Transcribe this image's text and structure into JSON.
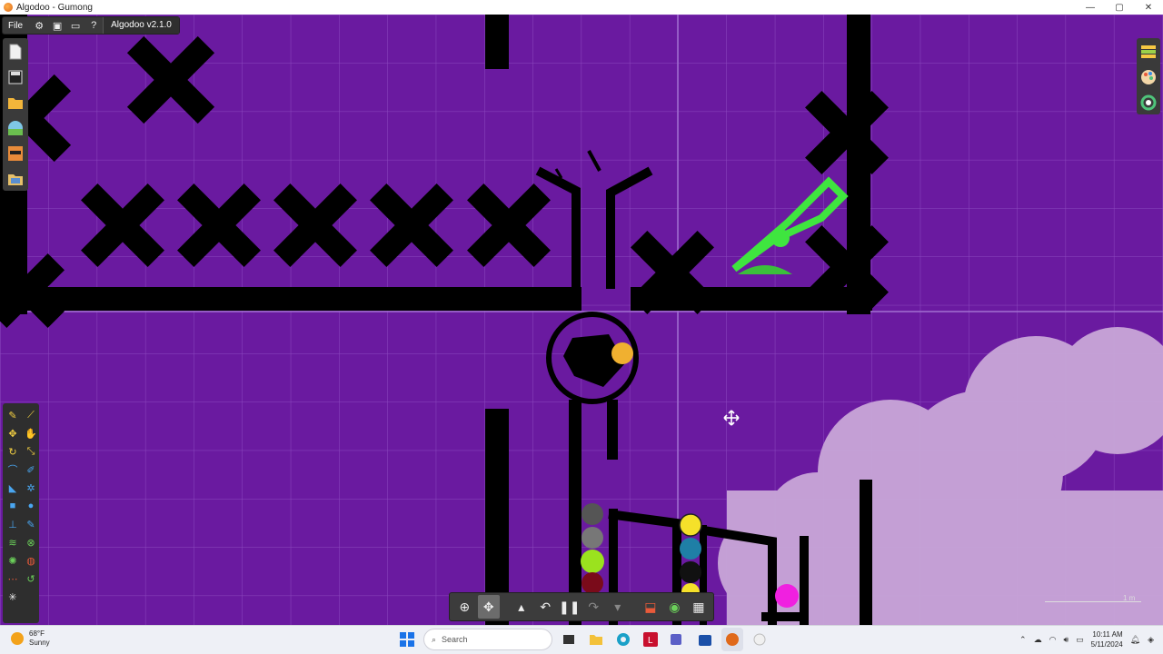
{
  "window": {
    "title": "Algodoo - Gumong",
    "controls": {
      "minimize": "—",
      "maximize": "▢",
      "close": "✕"
    }
  },
  "menu": {
    "file_label": "File",
    "version_label": "Algodoo v2.1.0",
    "buttons": [
      {
        "name": "settings-gear-icon",
        "glyph": "⚙"
      },
      {
        "name": "screen-icon",
        "glyph": "▣"
      },
      {
        "name": "window-icon",
        "glyph": "▭"
      },
      {
        "name": "help-icon",
        "glyph": "?"
      }
    ]
  },
  "left_toolbar": [
    {
      "name": "new-scene-icon",
      "color": "#f1f1f1"
    },
    {
      "name": "save-icon",
      "color": "#e6e6e6"
    },
    {
      "name": "open-folder-icon",
      "color": "#f3b63a"
    },
    {
      "name": "scene-browser-icon",
      "color": "#7fc7e6"
    },
    {
      "name": "character-icon",
      "color": "#e88b3a"
    },
    {
      "name": "library-icon",
      "color": "#e6c06a"
    }
  ],
  "right_toolbar": [
    {
      "name": "layers-icon",
      "color": "#f5c842"
    },
    {
      "name": "palette-icon",
      "color": "#e85a3a"
    },
    {
      "name": "visualization-icon",
      "color": "#4fc47a"
    }
  ],
  "tools": [
    {
      "name": "sketch-tool-icon",
      "glyph": "✎",
      "color": "#f5d142"
    },
    {
      "name": "cut-tool-icon",
      "glyph": "⟋",
      "color": "#f5d142"
    },
    {
      "name": "move-tool-icon",
      "glyph": "✥",
      "color": "#f5d142"
    },
    {
      "name": "drag-tool-icon",
      "glyph": "✋",
      "color": "#f5d142"
    },
    {
      "name": "rotate-tool-icon",
      "glyph": "↻",
      "color": "#f5d142"
    },
    {
      "name": "scale-tool-icon",
      "glyph": "⤡",
      "color": "#f5d142"
    },
    {
      "name": "rope-tool-icon",
      "glyph": "⌒",
      "color": "#4aa6f0"
    },
    {
      "name": "brush-tool-icon",
      "glyph": "✐",
      "color": "#4aa6f0"
    },
    {
      "name": "plane-tool-icon",
      "glyph": "◣",
      "color": "#4aa6f0"
    },
    {
      "name": "gear-tool-icon",
      "glyph": "✲",
      "color": "#4aa6f0"
    },
    {
      "name": "box-tool-icon",
      "glyph": "■",
      "color": "#4aa6f0"
    },
    {
      "name": "circle-tool-icon",
      "glyph": "●",
      "color": "#4aa6f0"
    },
    {
      "name": "fixate-tool-icon",
      "glyph": "⊥",
      "color": "#4aa6f0"
    },
    {
      "name": "pen-tool-icon",
      "glyph": "✎",
      "color": "#4aa6f0"
    },
    {
      "name": "spring-tool-icon",
      "glyph": "≋",
      "color": "#6bd05a"
    },
    {
      "name": "axle-tool-icon",
      "glyph": "⊗",
      "color": "#6bd05a"
    },
    {
      "name": "thruster-tool-icon",
      "glyph": "✺",
      "color": "#6bd05a"
    },
    {
      "name": "tracer-tool-icon",
      "glyph": "◍",
      "color": "#e85a3a"
    },
    {
      "name": "chain-tool-icon",
      "glyph": "⋯",
      "color": "#e85a3a"
    },
    {
      "name": "laser-tool-icon",
      "glyph": "↺",
      "color": "#6bd05a"
    },
    {
      "name": "spawn-tool-icon",
      "glyph": "✳",
      "color": "#eeeeee"
    }
  ],
  "bottom_bar": {
    "zoom": "⊕",
    "pan": "✥",
    "up": "▴",
    "undo": "↶",
    "pause": "❚❚",
    "redo": "↷",
    "down": "▾",
    "gravity": "⬓",
    "air": "◉",
    "grid": "▦"
  },
  "scale": {
    "label": "1 m"
  },
  "taskbar": {
    "weather_temp": "68°F",
    "weather_desc": "Sunny",
    "search_placeholder": "Search",
    "time": "10:11 AM",
    "date": "5/11/2024"
  }
}
